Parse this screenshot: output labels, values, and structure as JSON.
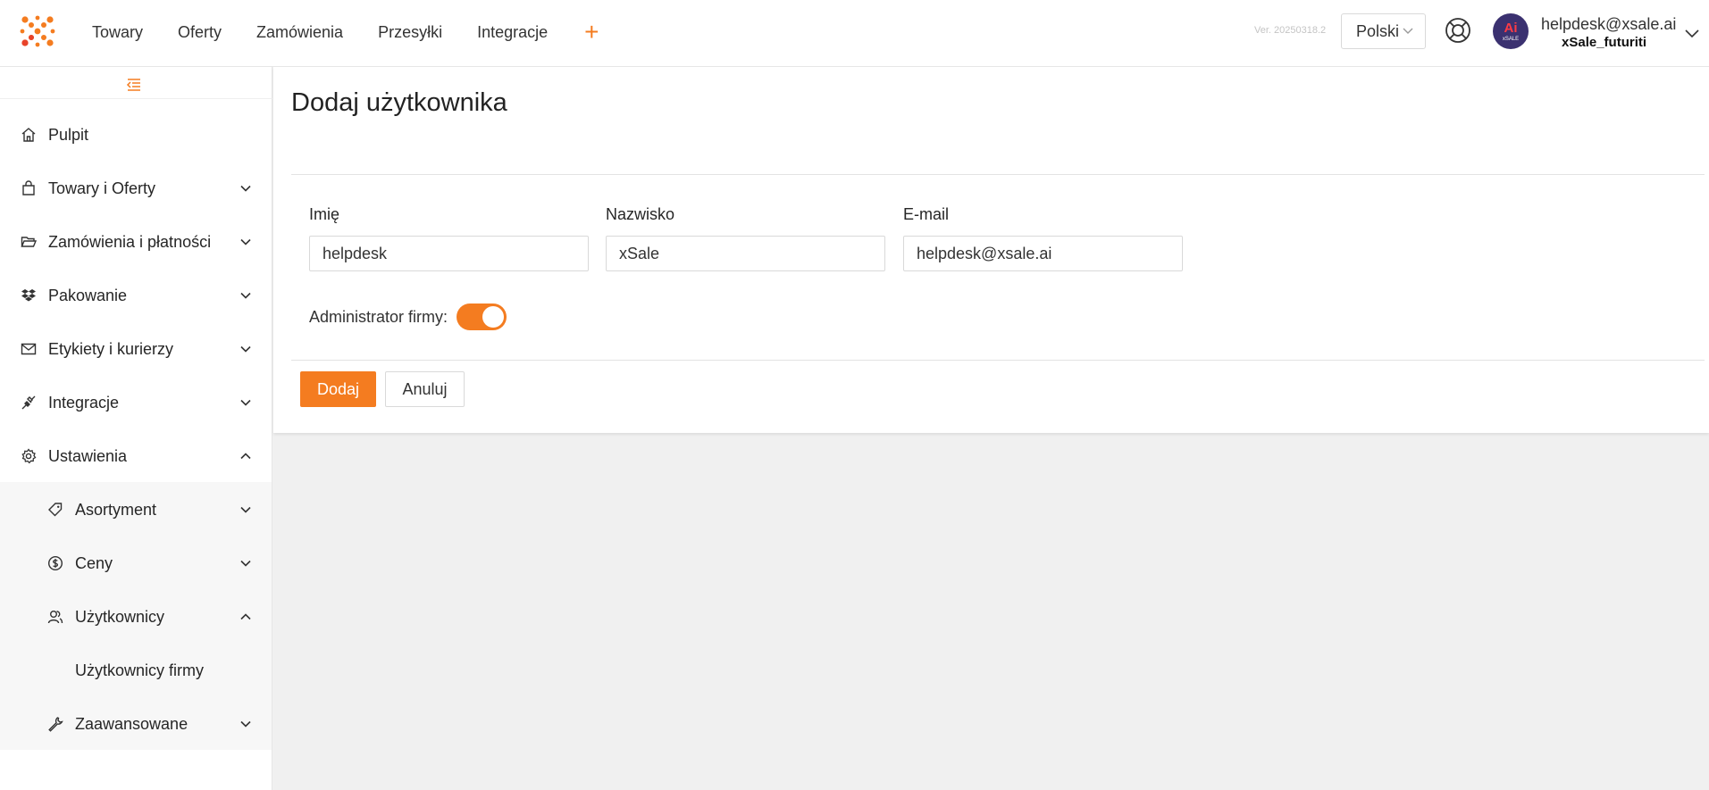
{
  "colors": {
    "accent": "#f47c20",
    "avatar_bg": "#3b3170",
    "avatar_text": "#ff3b45"
  },
  "topnav": {
    "items": [
      "Towary",
      "Oferty",
      "Zamówienia",
      "Przesyłki",
      "Integracje"
    ],
    "plus_label": "+"
  },
  "header": {
    "version": "Ver. 20250318.2",
    "language": "Polski",
    "user_email": "helpdesk@xsale.ai",
    "user_company": "xSale_futuriti",
    "avatar_main": "Ai",
    "avatar_sub": "xSALE"
  },
  "sidebar": {
    "items": [
      {
        "label": "Pulpit",
        "icon": "home-icon"
      },
      {
        "label": "Towary i Oferty",
        "icon": "bag-icon"
      },
      {
        "label": "Zamówienia i płatności",
        "icon": "folder-icon"
      },
      {
        "label": "Pakowanie",
        "icon": "dropbox-icon"
      },
      {
        "label": "Etykiety i kurierzy",
        "icon": "mail-icon"
      },
      {
        "label": "Integracje",
        "icon": "plug-icon"
      },
      {
        "label": "Ustawienia",
        "icon": "gear-icon"
      }
    ],
    "sub_items": [
      {
        "label": "Asortyment",
        "icon": "tag-icon"
      },
      {
        "label": "Ceny",
        "icon": "dollar-icon"
      },
      {
        "label": "Użytkownicy",
        "icon": "users-icon"
      },
      {
        "label": "Użytkownicy firmy"
      },
      {
        "label": "Zaawansowane",
        "icon": "wrench-icon"
      }
    ]
  },
  "main": {
    "title": "Dodaj użytkownika",
    "fields": {
      "first_name": {
        "label": "Imię",
        "value": "helpdesk"
      },
      "last_name": {
        "label": "Nazwisko",
        "value": "xSale"
      },
      "email": {
        "label": "E-mail",
        "value": "helpdesk@xsale.ai"
      }
    },
    "admin_label": "Administrator firmy:",
    "admin_enabled": true,
    "add_button": "Dodaj",
    "cancel_button": "Anuluj"
  }
}
